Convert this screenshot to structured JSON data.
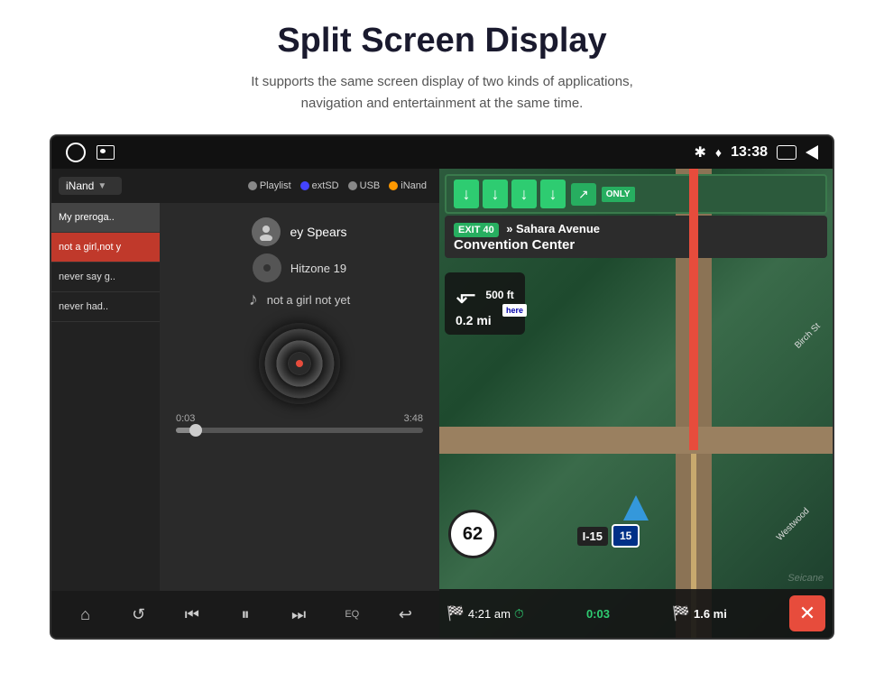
{
  "header": {
    "title": "Split Screen Display",
    "subtitle": "It supports the same screen display of two kinds of applications,\nnavigation and entertainment at the same time."
  },
  "status_bar": {
    "time": "13:38",
    "bluetooth_icon": "bluetooth",
    "location_icon": "location-pin"
  },
  "music_panel": {
    "source_dropdown": {
      "label": "iNand",
      "options": [
        "Playlist",
        "extSD",
        "USB",
        "iNand"
      ]
    },
    "playlist": [
      {
        "label": "My preroga..",
        "active": false
      },
      {
        "label": "not a girl,not y",
        "active": true
      },
      {
        "label": "never say g..",
        "active": false
      },
      {
        "label": "never had..",
        "active": false
      }
    ],
    "artist": "ey Spears",
    "album": "Hitzone 19",
    "song": "not a girl not yet",
    "progress": {
      "current": "0:03",
      "total": "3:48",
      "percent": 8
    },
    "controls": {
      "home": "⌂",
      "repeat": "↺",
      "prev": "⏮",
      "pause": "⏸",
      "next": "⏭",
      "eq": "EQ",
      "back": "↩"
    }
  },
  "nav_panel": {
    "exit_number": "EXIT 40",
    "exit_street": "» Sahara Avenue",
    "exit_venue": "Convention Center",
    "turn_distance": "0.2 mi",
    "speed": "62",
    "highway": "I-15",
    "highway_num": "15",
    "arrival_time": "4:21 am",
    "duration": "0:03",
    "remaining": "1.6 mi",
    "only_label": "ONLY",
    "here_brand": "here"
  }
}
